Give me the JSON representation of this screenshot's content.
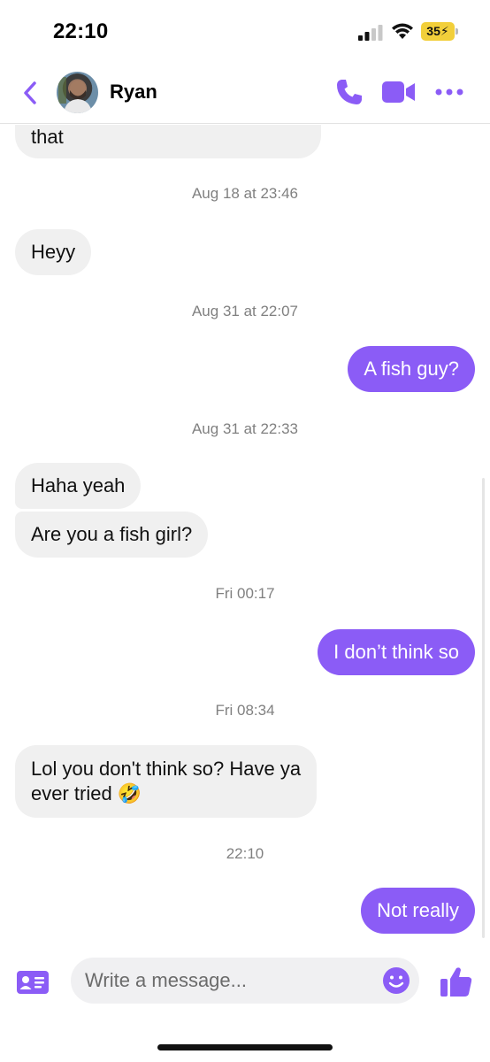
{
  "status_bar": {
    "time": "22:10",
    "battery": "35"
  },
  "header": {
    "contact_name": "Ryan"
  },
  "colors": {
    "accent": "#8b5cf6",
    "incoming_bubble": "#f0f0f0",
    "battery": "#f2cf3a"
  },
  "messages": [
    {
      "type": "incoming",
      "text": "that"
    },
    {
      "type": "timestamp",
      "text": "Aug 18 at 23:46"
    },
    {
      "type": "incoming",
      "text": "Heyy"
    },
    {
      "type": "timestamp",
      "text": "Aug 31 at 22:07"
    },
    {
      "type": "outgoing",
      "text": "A fish guy?"
    },
    {
      "type": "timestamp",
      "text": "Aug 31 at 22:33"
    },
    {
      "type": "incoming",
      "text": "Haha yeah"
    },
    {
      "type": "incoming",
      "text": "Are you a fish girl?"
    },
    {
      "type": "timestamp",
      "text": "Fri 00:17"
    },
    {
      "type": "outgoing",
      "text": "I don’t think so"
    },
    {
      "type": "timestamp",
      "text": "Fri 08:34"
    },
    {
      "type": "incoming",
      "text": "Lol you don't think so? Have ya",
      "text2": "ever tried 🤣"
    },
    {
      "type": "timestamp",
      "text": "22:10"
    },
    {
      "type": "outgoing",
      "text": "Not really"
    }
  ],
  "composer": {
    "placeholder": "Write a message..."
  },
  "icons": {
    "back": "chevron-left-icon",
    "call": "phone-icon",
    "video": "video-camera-icon",
    "more": "more-dots-icon",
    "contact_card": "contact-card-icon",
    "emoji": "smiley-icon",
    "like": "thumbs-up-icon"
  }
}
